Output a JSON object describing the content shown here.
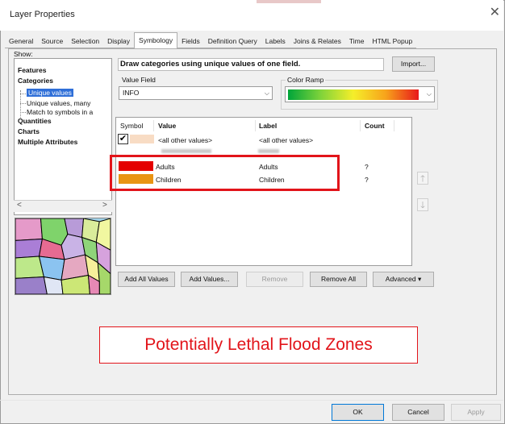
{
  "window": {
    "title": "Layer Properties",
    "close_glyph": "✕"
  },
  "tabs": [
    {
      "label": "General"
    },
    {
      "label": "Source"
    },
    {
      "label": "Selection"
    },
    {
      "label": "Display"
    },
    {
      "label": "Symbology",
      "active": true
    },
    {
      "label": "Fields"
    },
    {
      "label": "Definition Query"
    },
    {
      "label": "Labels"
    },
    {
      "label": "Joins & Relates"
    },
    {
      "label": "Time"
    },
    {
      "label": "HTML Popup"
    }
  ],
  "show": {
    "label": "Show:",
    "items": [
      {
        "label": "Features",
        "bold": true
      },
      {
        "label": "Categories",
        "bold": true
      },
      {
        "label": "Unique values",
        "selected": true
      },
      {
        "label": "Unique values, many"
      },
      {
        "label": "Match to symbols in a"
      },
      {
        "label": "Quantities",
        "bold": true
      },
      {
        "label": "Charts",
        "bold": true
      },
      {
        "label": "Multiple Attributes",
        "bold": true
      }
    ]
  },
  "symbology": {
    "heading": "Draw categories using unique values of one field.",
    "import_label": "Import...",
    "value_field": {
      "label": "Value Field",
      "value": "INFO"
    },
    "color_ramp": {
      "label": "Color Ramp"
    },
    "columns": {
      "symbol": "Symbol",
      "value": "Value",
      "label": "Label",
      "count": "Count"
    },
    "rows": [
      {
        "value": "<all other values>",
        "label": "<all other values>",
        "count": "",
        "color": "#f8dcc4",
        "checked": true
      },
      {
        "value": "Adults",
        "label": "Adults",
        "count": "?",
        "color": "#e40000"
      },
      {
        "value": "Children",
        "label": "Children",
        "count": "?",
        "color": "#e99413"
      }
    ],
    "buttons": {
      "add_all": "Add All Values",
      "add_values": "Add Values...",
      "remove": "Remove",
      "remove_all": "Remove All",
      "advanced": "Advanced ▾"
    }
  },
  "callout": {
    "text": "Potentially Lethal Flood Zones",
    "color": "#e2141a"
  },
  "footer": {
    "ok": "OK",
    "cancel": "Cancel",
    "apply": "Apply"
  },
  "icons": {
    "move_up": "🡑",
    "move_down": "🡓",
    "scroll_left": "<",
    "scroll_right": ">",
    "dropdown": "⌵",
    "check": "✔"
  },
  "colors": {
    "accent_highlight": "#e2141a",
    "selection": "#2f6fd8"
  }
}
